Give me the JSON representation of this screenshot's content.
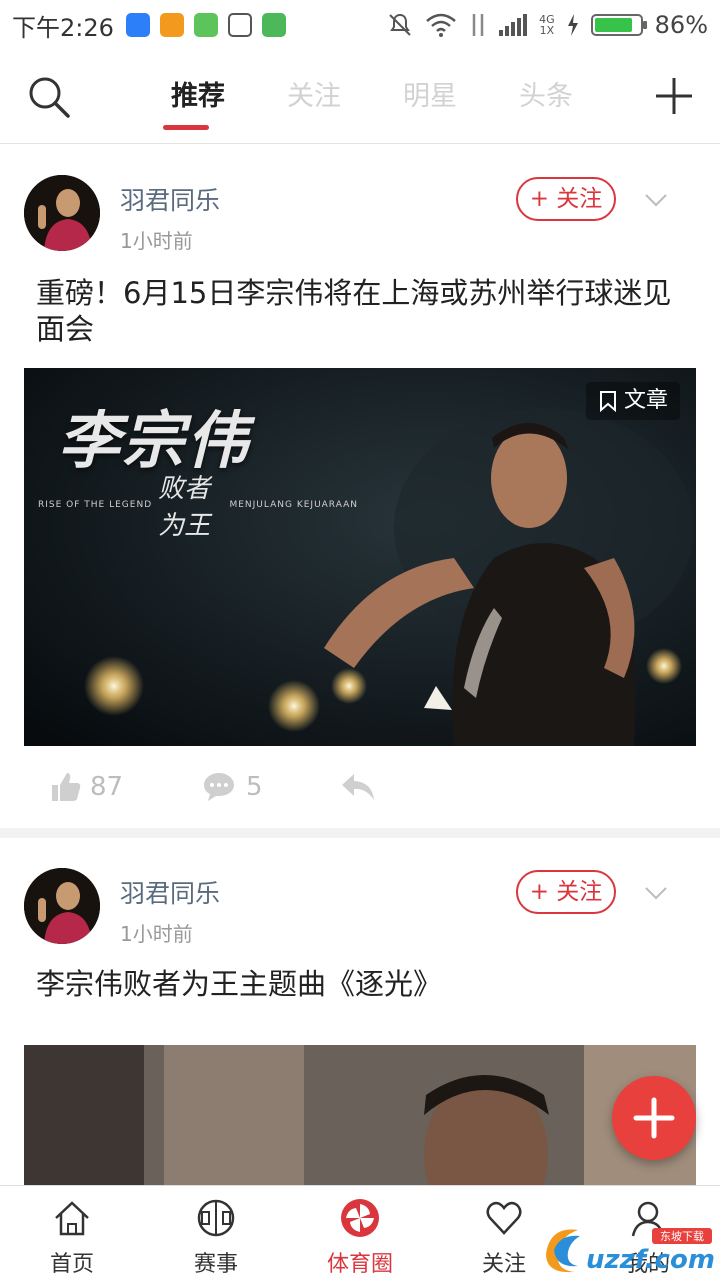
{
  "status_bar": {
    "time": "下午2:26",
    "network": "4G",
    "network_sub": "1X",
    "battery_percent": 86,
    "battery_text": "86%",
    "colors": {
      "battery_fill": "#37c24a"
    }
  },
  "top_nav": {
    "tabs": [
      {
        "label": "推荐",
        "active": true
      },
      {
        "label": "关注",
        "active": false
      },
      {
        "label": "明星",
        "active": false
      },
      {
        "label": "头条",
        "active": false
      }
    ],
    "icons": {
      "left": "search-icon",
      "right": "plus-icon"
    }
  },
  "posts": [
    {
      "author": "羽君同乐",
      "time": "1小时前",
      "follow_label": "+ 关注",
      "headline": "重磅！6月15日李宗伟将在上海或苏州举行球迷见面会",
      "cover": {
        "tag": "文章",
        "title_text": "李宗伟",
        "sub_left": "RISE OF THE LEGEND",
        "sub_big": "败者为王",
        "sub_right": "MENJULANG KEJUARAAN"
      },
      "likes": "87",
      "comments": "5"
    },
    {
      "author": "羽君同乐",
      "time": "1小时前",
      "follow_label": "+ 关注",
      "headline": "李宗伟败者为王主题曲《逐光》"
    }
  ],
  "bottom_bar": {
    "tabs": [
      {
        "label": "首页",
        "icon": "home-icon",
        "active": false
      },
      {
        "label": "赛事",
        "icon": "court-icon",
        "active": false
      },
      {
        "label": "体育圈",
        "icon": "pinwheel-icon",
        "active": true
      },
      {
        "label": "关注",
        "icon": "heart-icon",
        "active": false
      },
      {
        "label": "我的",
        "icon": "profile-icon",
        "active": false
      }
    ]
  },
  "watermark": {
    "text": "uzzf.com",
    "sub": "东坡下载"
  },
  "colors": {
    "accent": "#d9363e",
    "fab": "#e8403c",
    "author": "#5a6b80"
  }
}
